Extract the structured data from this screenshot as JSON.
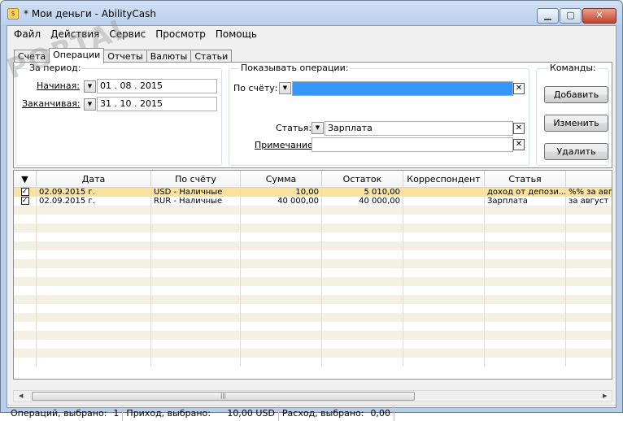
{
  "window": {
    "title": "* Мои деньги - AbilityCash",
    "minimize_glyph": "▁",
    "maximize_glyph": "▢",
    "close_glyph": "✕"
  },
  "menu": [
    "Файл",
    "Действия",
    "Сервис",
    "Просмотр",
    "Помощь"
  ],
  "tabs": [
    "Счета",
    "Операции",
    "Отчеты",
    "Валюты",
    "Статьи"
  ],
  "active_tab": "Операции",
  "period": {
    "title": "За период:",
    "start_label": "Начиная:",
    "start_value": "01 . 08 . 2015",
    "end_label": "Заканчивая:",
    "end_value": "31 . 10 . 2015"
  },
  "filters": {
    "title": "Показывать операции:",
    "account_label": "По счёту:",
    "account_value": "",
    "category_label": "Статья:",
    "category_value": "Зарплата",
    "note_label": "Примечание:",
    "note_value": ""
  },
  "commands": {
    "title": "Команды:",
    "add": "Добавить",
    "edit": "Изменить",
    "delete": "Удалить"
  },
  "grid": {
    "columns": [
      "",
      "Дата",
      "По счёту",
      "Сумма",
      "Остаток",
      "Корреспондент",
      "Статья",
      ""
    ],
    "rows": [
      {
        "checked": true,
        "date": "02.09.2015 г.",
        "account": "USD - Наличные",
        "amount": "10,00",
        "balance": "5 010,00",
        "correspondent": "",
        "category": "доход от депози...",
        "note": "%% за авгу"
      },
      {
        "checked": true,
        "date": "02.09.2015 г.",
        "account": "RUR - Наличные",
        "amount": "40 000,00",
        "balance": "40 000,00",
        "correspondent": "",
        "category": "Зарплата",
        "note": "за август"
      }
    ],
    "selected_row_color": "#fbe0a0",
    "stripe_color": "#f4f0e2"
  },
  "status": {
    "ops_label": "Операций, выбрано:",
    "ops_value": "1",
    "income_label": "Приход, выбрано:",
    "income_value": "10,00 USD",
    "expense_label": "Расход, выбрано:",
    "expense_value": "0,00"
  },
  "watermark": "PORTAL"
}
